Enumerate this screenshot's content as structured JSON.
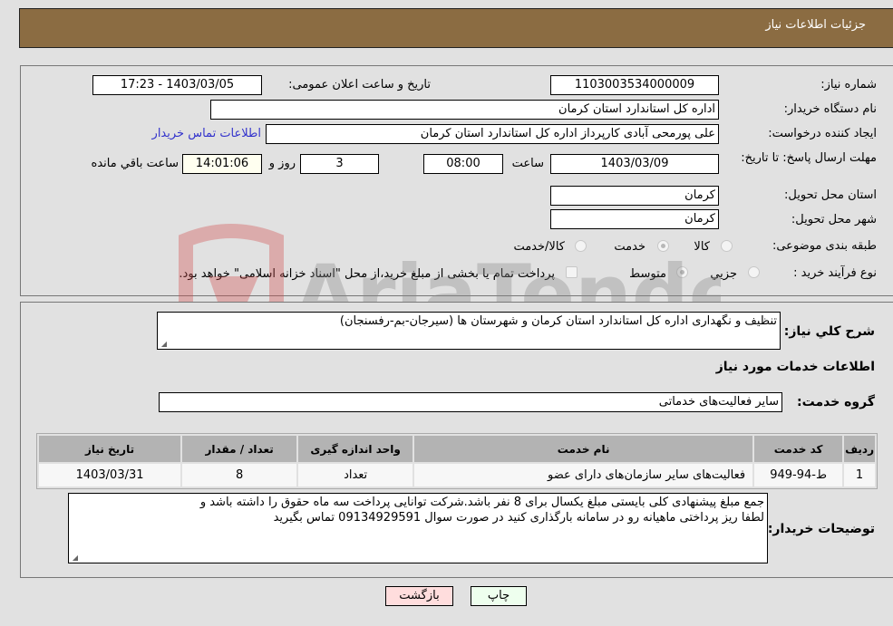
{
  "header": {
    "title": "جزئیات اطلاعات نیاز"
  },
  "form": {
    "need_number": {
      "label": "شماره نیاز:",
      "value": "1103003534000009"
    },
    "announce_datetime": {
      "label": "تاریخ و ساعت اعلان عمومی:",
      "value": "1403/03/05 - 17:23"
    },
    "buyer_org": {
      "label": "نام دستگاه خریدار:",
      "value": "اداره کل استاندارد استان کرمان"
    },
    "creator": {
      "label": "ایجاد کننده درخواست:",
      "value": "علی پورمحی آبادی کارپرداز اداره کل استاندارد استان کرمان"
    },
    "buyer_contact_link": "اطلاعات تماس خریدار",
    "deadline": {
      "label": "مهلت ارسال پاسخ: تا تاریخ:",
      "date": "1403/03/09",
      "time_label": "ساعت",
      "time": "08:00",
      "days": "3",
      "days_label": "روز و",
      "remaining": "14:01:06",
      "remaining_label": "ساعت باقي مانده"
    },
    "province": {
      "label": "استان محل تحویل:",
      "value": "کرمان"
    },
    "city": {
      "label": "شهر محل تحویل:",
      "value": "کرمان"
    },
    "category": {
      "label": "طبقه بندی موضوعی:",
      "options": [
        "کالا",
        "خدمت",
        "کالا/خدمت"
      ],
      "selected": "خدمت"
    },
    "process": {
      "label": "نوع فرآیند خرید :",
      "options": [
        "جزیي",
        "متوسط"
      ],
      "selected": "متوسط",
      "treasury_note": "پرداخت تمام یا بخشی از مبلغ خرید،از محل \"اسناد خزانه اسلامی\" خواهد بود."
    }
  },
  "details": {
    "summary_label": "شرح کلي نياز:",
    "summary": "تنظیف و نگهداری اداره کل استاندارد استان کرمان و شهرستان ها (سیرجان-بم-رفسنجان)",
    "services_title": "اطلاعات خدمات مورد نياز",
    "service_group_label": "گروه خدمت:",
    "service_group": "سایر فعالیت‌های خدماتی",
    "table": {
      "headers": [
        "ردیف",
        "کد خدمت",
        "نام خدمت",
        "واحد اندازه گیری",
        "تعداد / مقدار",
        "تاریخ نیاز"
      ],
      "rows": [
        [
          "1",
          "ط-94-949",
          "فعالیت‌های سایر سازمان‌های دارای عضو",
          "تعداد",
          "8",
          "1403/03/31"
        ]
      ]
    },
    "buyer_notes_label": "توضیحات خریدار:",
    "buyer_notes_line1": "جمع مبلغ پیشنهادی کلی بایستی مبلغ یکسال برای 8 نفر باشد.شرکت توانایی پرداخت سه ماه حقوق را داشته باشد و",
    "buyer_notes_line2": "لطفا ریز پرداختی ماهیانه رو در سامانه بارگذاری کنید در صورت سوال 09134929591 تماس بگیرید"
  },
  "buttons": {
    "print": "چاپ",
    "back": "بازگشت"
  },
  "colors": {
    "header_bg": "#8b6c42",
    "print_bg": "#eeffee",
    "back_bg": "#ffdddd",
    "link": "#3333cc"
  },
  "watermark": "AriaTender.neT"
}
